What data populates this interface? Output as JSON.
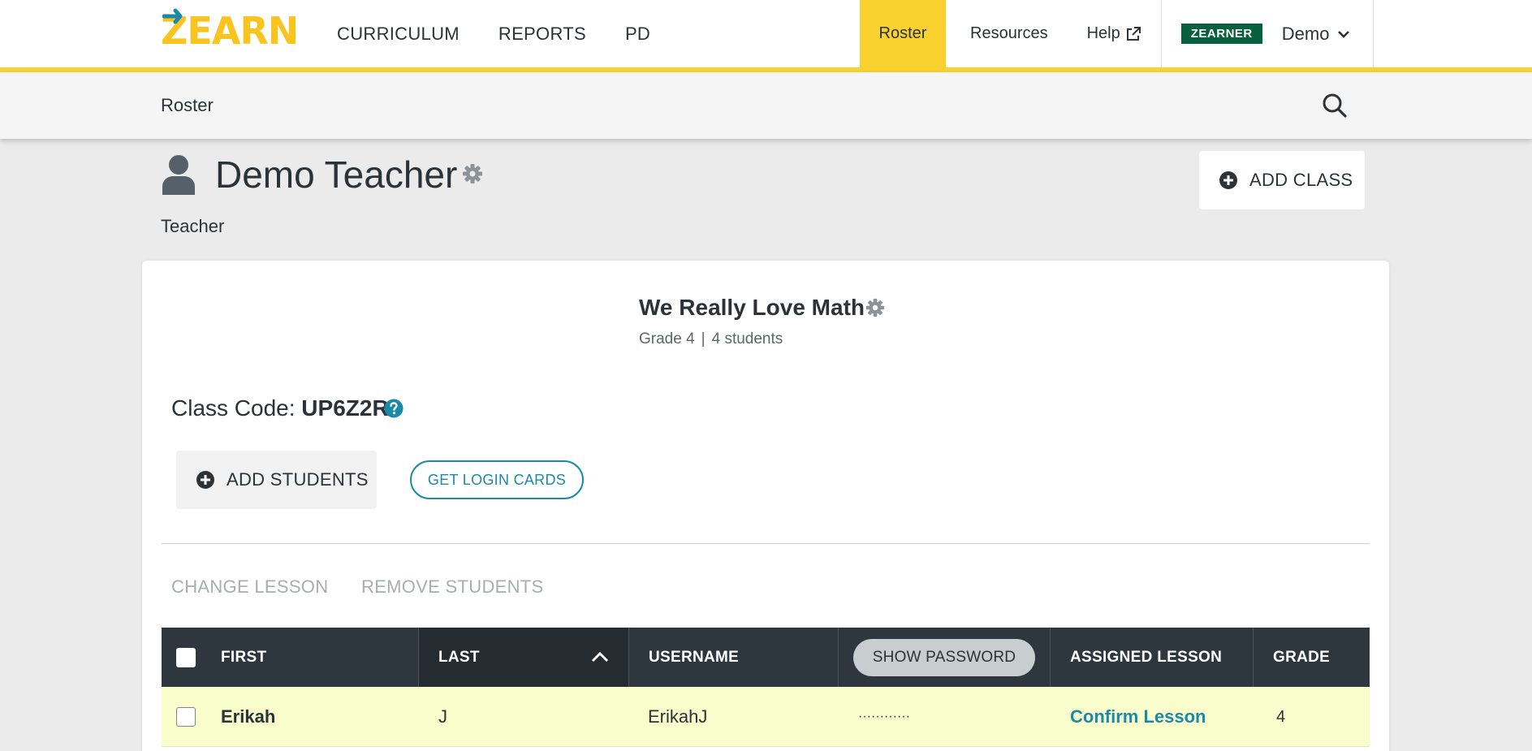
{
  "nav": {
    "logo": "ZEARN",
    "main_items": [
      "CURRICULUM",
      "REPORTS",
      "PD"
    ],
    "roster": "Roster",
    "resources": "Resources",
    "help": "Help",
    "badge": "ZEARNER",
    "user": "Demo"
  },
  "subbar": {
    "breadcrumb": "Roster"
  },
  "teacher": {
    "name": "Demo Teacher",
    "role": "Teacher",
    "add_class_label": "ADD CLASS"
  },
  "class": {
    "title": "We Really Love Math",
    "grade": "Grade 4",
    "separator": "|",
    "students": "4 students",
    "code_label": "Class Code:",
    "code": "UP6Z2R",
    "add_students_label": "ADD STUDENTS",
    "login_cards_label": "GET LOGIN CARDS",
    "change_lesson_label": "CHANGE LESSON",
    "remove_students_label": "REMOVE STUDENTS"
  },
  "table": {
    "headers": {
      "first": "FIRST",
      "last": "LAST",
      "username": "USERNAME",
      "show_password": "SHOW PASSWORD",
      "assigned_lesson": "ASSIGNED LESSON",
      "grade": "GRADE"
    },
    "rows": [
      {
        "first": "Erikah",
        "last": "J",
        "username": "ErikahJ",
        "password": "············",
        "lesson": "Confirm Lesson",
        "grade": "4"
      }
    ]
  },
  "colors": {
    "brand_yellow": "#f9d230",
    "header_dark": "#2d373d",
    "link_teal": "#1a8aa8",
    "badge_green": "#06603f",
    "row_highlight": "#f9fdcc"
  }
}
